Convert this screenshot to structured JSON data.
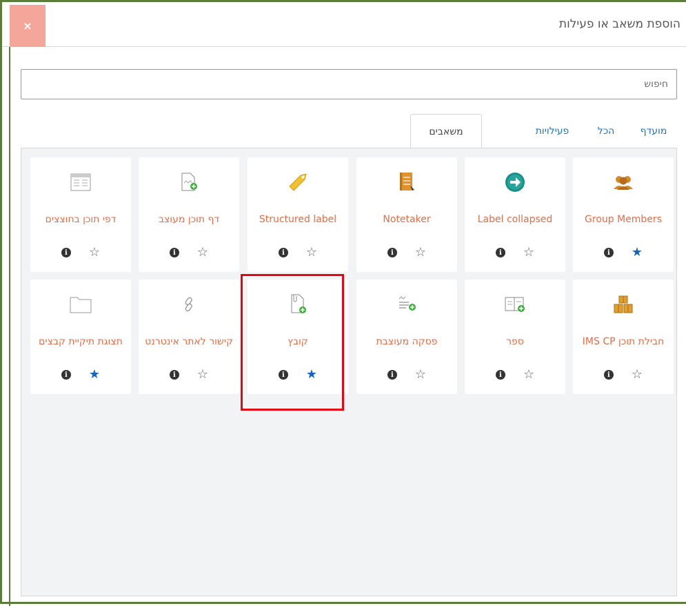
{
  "modal": {
    "title": "הוספת משאב או פעילות",
    "close_glyph": "×"
  },
  "search": {
    "placeholder": "חיפוש"
  },
  "tabs": [
    {
      "label": "מועדף",
      "active": false
    },
    {
      "label": "הכל",
      "active": false
    },
    {
      "label": "פעילויות",
      "active": false
    },
    {
      "label": "משאבים",
      "active": true
    }
  ],
  "cards": [
    {
      "name": "Group Members",
      "icon": "group-icon",
      "favorite": true
    },
    {
      "name": "Label collapsed",
      "icon": "arrow-circle-icon",
      "favorite": false
    },
    {
      "name": "Notetaker",
      "icon": "notebook-icon",
      "favorite": false
    },
    {
      "name": "Structured label",
      "icon": "tag-icon",
      "favorite": false
    },
    {
      "name": "דף תוכן מעוצב",
      "icon": "page-add-icon",
      "favorite": false
    },
    {
      "name": "דפי תוכן בחוצצים",
      "icon": "tabbed-pages-icon",
      "favorite": false
    },
    {
      "name": "חבילת תוכן IMS CP",
      "icon": "package-icon",
      "favorite": false
    },
    {
      "name": "ספר",
      "icon": "book-icon",
      "favorite": false
    },
    {
      "name": "פסקה מעוצבת",
      "icon": "paragraph-icon",
      "favorite": false
    },
    {
      "name": "קובץ",
      "icon": "file-icon",
      "favorite": true
    },
    {
      "name": "קישור לאתר אינטרנט",
      "icon": "link-icon",
      "favorite": false
    },
    {
      "name": "תצוגת תיקיית קבצים",
      "icon": "folder-icon",
      "favorite": true
    }
  ],
  "info_glyph": "i",
  "star_glyph": "★",
  "star_empty_glyph": "☆",
  "colors": {
    "accent": "#1565c0",
    "link": "#e86b44",
    "close_bg": "#f4a69b",
    "highlight": "#e30613"
  }
}
